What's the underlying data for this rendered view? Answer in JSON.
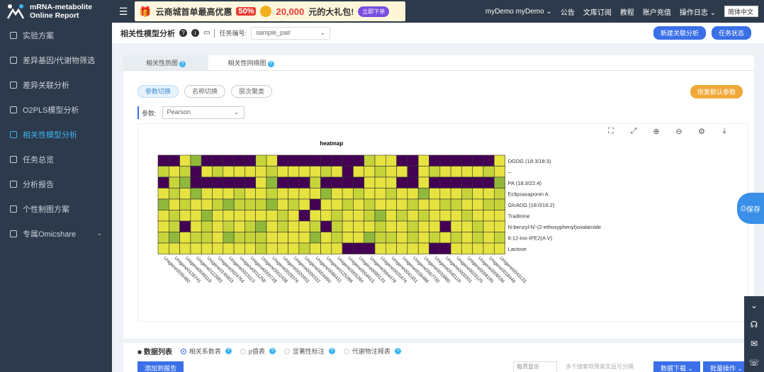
{
  "app": {
    "logo_line1": "mRNA-metabolite",
    "logo_line2": "Online Report"
  },
  "sidebar": {
    "items": [
      {
        "label": "实验方案",
        "icon": "gear-icon"
      },
      {
        "label": "差异基因/代谢物筛选",
        "icon": "filter-icon"
      },
      {
        "label": "差异关联分析",
        "icon": "monitor-icon"
      },
      {
        "label": "O2PLS模型分析",
        "icon": "chart-icon"
      },
      {
        "label": "相关性模型分析",
        "icon": "book-icon",
        "active": true
      },
      {
        "label": "任务总览",
        "icon": "globe-icon"
      },
      {
        "label": "分析报告",
        "icon": "report-icon"
      },
      {
        "label": "个性制图方案",
        "icon": "palette-icon"
      },
      {
        "label": "专属Omicshare",
        "icon": "search-icon",
        "arrow": "⌄"
      }
    ]
  },
  "topbar": {
    "banner_text": "云商城首单最高优惠",
    "banner_pct": "50%",
    "banner_amount": "20,000",
    "banner_tail": "元的大礼包!",
    "banner_btn": "立即下单",
    "user": "myDemo myDemo",
    "links": [
      "公告",
      "文库订阅",
      "教程",
      "账户充值",
      "操作日志"
    ],
    "lang": "简体中文"
  },
  "header": {
    "title": "相关性模型分析",
    "task_label": "任务编号:",
    "task_value": "sample_pair",
    "btn_new": "新建关联分析",
    "btn_task": "任务状态"
  },
  "tabs": [
    {
      "label": "相关性热图"
    },
    {
      "label": "相关性网络图"
    }
  ],
  "chips": [
    "参数切换",
    "名称切换",
    "层次聚类"
  ],
  "redraw": "恢复默认参数",
  "params": {
    "label": "参数:",
    "method": "Pearson"
  },
  "toolbar_icons": [
    "fullscreen-icon",
    "exit-fullscreen-icon",
    "zoom-in-icon",
    "zoom-out-icon",
    "settings-icon",
    "download-icon"
  ],
  "chart_data": {
    "type": "heatmap",
    "title": "heatmap",
    "rows": [
      "DGDG (18:3/18:3)",
      "--",
      "PA (18:3/22:4)",
      "Eclipsasaponin A",
      "GlcADG (18:0/16:2)",
      "Tradinine",
      "N-benzyl-N'-(2-ethoxyphenyl)oxalamide",
      "8:12-ino-IPE2(A V)",
      "Lactose"
    ],
    "columns": [
      "Unigene0035480",
      "Unigene0128741",
      "Unigene0049118",
      "Unigene0122682",
      "Unigene0145653",
      "Unigene0024764",
      "Unigene0023113",
      "Unigene0011258",
      "Unigene0000728",
      "Unigene0002438",
      "Unigene0029376",
      "Unigene0020452",
      "Unigene0000332",
      "Unigene0004460",
      "Unigene0066411",
      "Unigene0125288",
      "Unigene0005394",
      "Unigene0004615",
      "Unigene0095133",
      "Unigene0064478",
      "Unigene0025476",
      "Unigene0041451",
      "Unigene0036488",
      "Unigene0067730",
      "Unigene0033880",
      "Unigene0040119",
      "Unigene0000301",
      "Unigene0029125",
      "Unigene0006185",
      "Unigene0006536",
      "Unigene0018448",
      "Unigene0043133"
    ],
    "colors": [
      "#440154",
      "#90b83a",
      "#c6d43a",
      "#e6e340"
    ],
    "levels": [
      [
        0,
        0,
        3,
        1,
        0,
        0,
        0,
        0,
        0,
        2,
        3,
        0,
        0,
        0,
        0,
        0,
        0,
        0,
        0,
        2,
        3,
        3,
        0,
        0,
        3,
        0,
        0,
        0,
        0,
        0,
        0,
        3
      ],
      [
        2,
        3,
        2,
        0,
        3,
        2,
        3,
        3,
        3,
        3,
        2,
        3,
        3,
        3,
        3,
        2,
        3,
        0,
        3,
        3,
        2,
        3,
        3,
        0,
        3,
        2,
        3,
        3,
        3,
        3,
        2,
        3
      ],
      [
        0,
        2,
        1,
        0,
        0,
        0,
        0,
        0,
        0,
        3,
        1,
        0,
        0,
        0,
        2,
        0,
        0,
        0,
        0,
        3,
        3,
        3,
        0,
        0,
        3,
        0,
        0,
        0,
        0,
        0,
        0,
        1
      ],
      [
        3,
        2,
        3,
        1,
        3,
        3,
        3,
        2,
        3,
        3,
        2,
        3,
        3,
        3,
        3,
        1,
        3,
        3,
        2,
        3,
        3,
        2,
        3,
        3,
        1,
        3,
        3,
        3,
        2,
        3,
        3,
        2
      ],
      [
        1,
        3,
        2,
        3,
        3,
        2,
        1,
        2,
        2,
        2,
        1,
        3,
        2,
        3,
        0,
        3,
        3,
        2,
        3,
        2,
        3,
        3,
        3,
        2,
        3,
        3,
        2,
        2,
        3,
        3,
        2,
        2
      ],
      [
        3,
        2,
        3,
        3,
        1,
        3,
        3,
        3,
        3,
        3,
        3,
        2,
        3,
        0,
        3,
        3,
        2,
        3,
        3,
        2,
        1,
        3,
        2,
        3,
        2,
        3,
        3,
        3,
        2,
        3,
        3,
        3
      ],
      [
        3,
        2,
        0,
        3,
        2,
        3,
        2,
        3,
        2,
        1,
        3,
        2,
        3,
        3,
        2,
        0,
        2,
        3,
        3,
        3,
        2,
        3,
        3,
        2,
        3,
        3,
        0,
        3,
        3,
        2,
        3,
        3
      ],
      [
        2,
        1,
        3,
        2,
        2,
        3,
        1,
        2,
        2,
        2,
        3,
        3,
        3,
        3,
        1,
        3,
        2,
        3,
        3,
        1,
        2,
        2,
        3,
        2,
        3,
        2,
        3,
        2,
        3,
        2,
        3,
        2
      ],
      [
        3,
        3,
        3,
        3,
        3,
        3,
        3,
        3,
        3,
        2,
        3,
        3,
        3,
        2,
        3,
        3,
        3,
        0,
        0,
        0,
        3,
        3,
        3,
        3,
        3,
        0,
        0,
        3,
        3,
        3,
        3,
        3
      ]
    ]
  },
  "bottom": {
    "title": "数据列表",
    "radios": [
      {
        "label": "相关系数表",
        "on": true
      },
      {
        "label": "p值表",
        "on": false
      },
      {
        "label": "显著性标注",
        "on": false
      },
      {
        "label": "代谢物注释表",
        "on": false
      }
    ],
    "add_btn": "添加到报告",
    "pager": "每页显示",
    "search_placeholder": "多个搜索项用英文逗号分隔",
    "download_btn": "数据下载",
    "batch_btn": "批量操作"
  },
  "float": {
    "save_label": "保存"
  }
}
